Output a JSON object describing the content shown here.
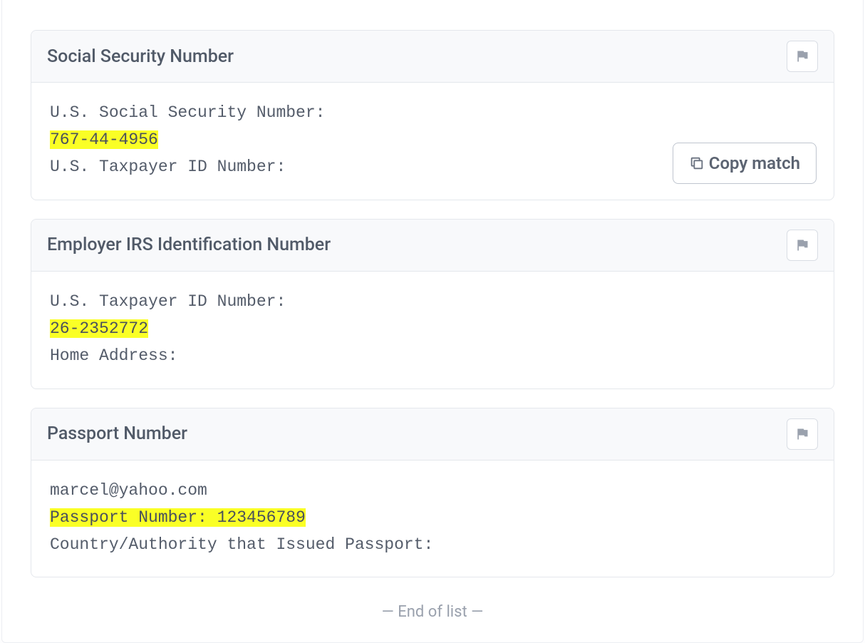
{
  "copy_label": "Copy match",
  "end_label": "— End of list —",
  "cards": [
    {
      "title": "Social Security Number",
      "show_copy": true,
      "line1": "U.S. Social Security Number:",
      "highlight": "767-44-4956",
      "line3": "U.S. Taxpayer ID Number:"
    },
    {
      "title": "Employer IRS Identification Number",
      "show_copy": false,
      "line1": "U.S. Taxpayer ID Number:",
      "highlight": "26-2352772",
      "line3": "Home Address:"
    },
    {
      "title": "Passport Number",
      "show_copy": false,
      "line1": "marcel@yahoo.com",
      "highlight": "Passport Number: 123456789",
      "line3": "Country/Authority that Issued Passport:"
    }
  ]
}
